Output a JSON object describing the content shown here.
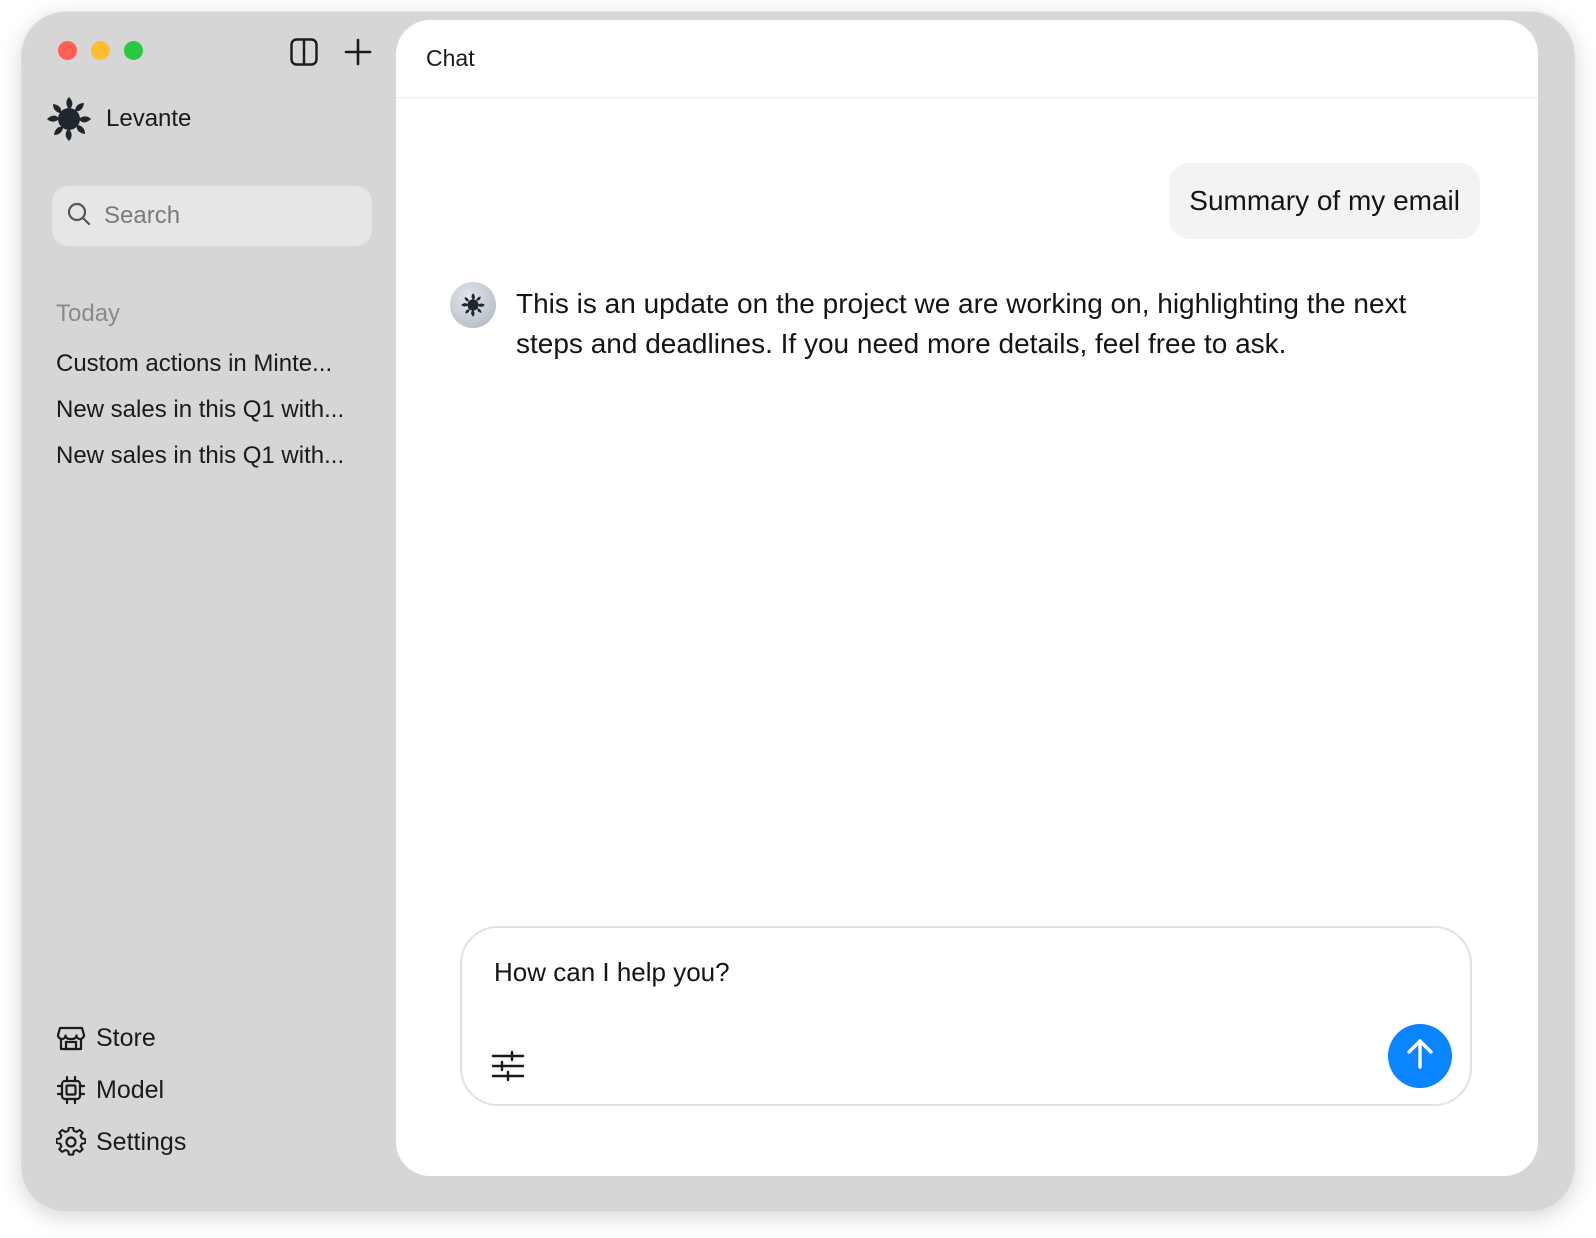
{
  "window": {
    "traffic_lights": [
      "close",
      "minimize",
      "zoom"
    ]
  },
  "sidebar": {
    "toolbar_icons": [
      "sidebar-toggle-icon",
      "plus-icon"
    ],
    "brand": {
      "name": "Levante",
      "logo_icon": "levante-logo-icon"
    },
    "search": {
      "placeholder": "Search",
      "value": ""
    },
    "section_label": "Today",
    "history": [
      {
        "label": "Custom actions in Minte..."
      },
      {
        "label": "New sales in this Q1 with..."
      },
      {
        "label": "New sales in this Q1 with..."
      }
    ],
    "bottom_nav": [
      {
        "label": "Store",
        "icon": "store-icon"
      },
      {
        "label": "Model",
        "icon": "chip-icon"
      },
      {
        "label": "Settings",
        "icon": "gear-icon"
      }
    ]
  },
  "main": {
    "title": "Chat",
    "messages": [
      {
        "role": "user",
        "text": "Summary of my email"
      },
      {
        "role": "assistant",
        "text": "This is an update on the project we are working on, highlighting the next steps and deadlines. If you need more details, feel free to ask."
      }
    ],
    "composer": {
      "placeholder": "How can I help you?",
      "value": "",
      "options_icon": "sliders-icon",
      "send_icon": "arrow-up-icon"
    }
  },
  "colors": {
    "sidebar_bg": "#d6d6d6",
    "accent": "#0a84ff",
    "close": "#ff5f57",
    "minimize": "#febc2e",
    "zoom": "#28c840"
  }
}
